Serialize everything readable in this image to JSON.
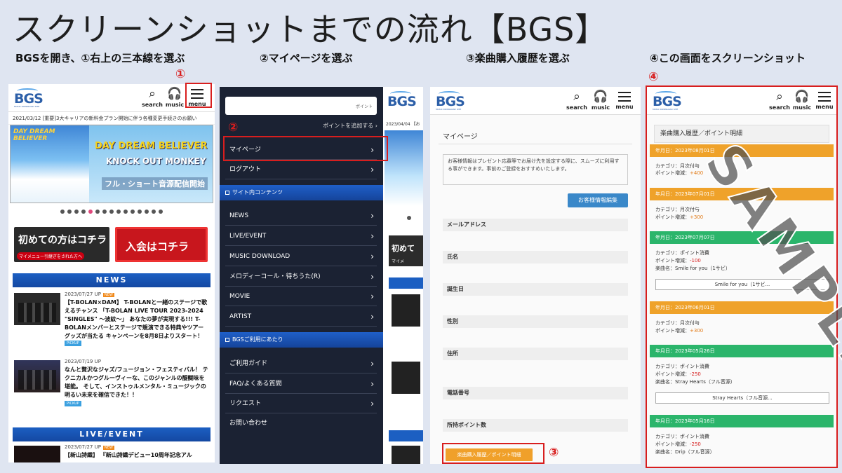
{
  "title": "スクリーンショットまでの流れ【BGS】",
  "steps": [
    "BGSを開き、①右上の三本線を選ぶ",
    "②マイページを選ぶ",
    "③楽曲購入履歴を選ぶ",
    "④この画面をスクリーンショット"
  ],
  "markers": [
    "①",
    "②",
    "③",
    "④"
  ],
  "header": {
    "logo": "BGS",
    "logo_sub": "MUSIC DOWNLOAD SITE",
    "search": "search",
    "music": "music",
    "menu": "menu"
  },
  "panel1": {
    "notice": "2021/03/12 [重要]3大キャリアの新料金プラン開始に伴う各種変更手続きのお願い",
    "banner": {
      "song": "DAY DREAM BELIEVER",
      "artist": "KNOCK OUT MONKEY",
      "caption": "フル・ショート音源配信開始"
    },
    "cta_first": "初めての方はコチラ",
    "cta_first_sub": "マイメニュー引継ぎをされた方へ",
    "cta_join": "入会はコチラ",
    "news_header": "NEWS",
    "news": [
      {
        "date": "2023/07/27 UP",
        "badge": "NEW",
        "text": "【T-BOLAN×DAM】 T-BOLANと一緒のステージで歌えるチャンス 「T-BOLAN LIVE TOUR 2023-2024 \"SINGLES\" ～波紋～」 あなたの夢が実現する!!! T-BOLANメンバーとステージで競演できる特典やツアーグッズが当たる キャンペーンを8月8日よりスタート！",
        "tag": "PICKUP"
      },
      {
        "date": "2023/07/19 UP",
        "badge": "",
        "text": "なんと贅沢なジャズ/フュージョン・フェスティバル！ テクニカルかつグルーヴィーな、このジャンルの醍醐味を堪能。 そして、インストゥルメンタル・ミュージックの明るい未来を確信できた！！",
        "tag": "PICKUP"
      }
    ],
    "live_header": "LIVE/EVENT",
    "live": [
      {
        "date": "2023/07/27 UP",
        "badge": "NEW",
        "text": "【新山詩織】 『新山詩織デビュー10周年記念アル"
      }
    ]
  },
  "panel2": {
    "search_placeholder": "ポイント",
    "points_add": "ポイントを追加する ›",
    "items_top": [
      "マイページ",
      "ログアウト"
    ],
    "section1": "サイト内コンテンツ",
    "items_mid": [
      "NEWS",
      "LIVE/EVENT",
      "MUSIC DOWNLOAD",
      "メロディーコール・待ちうた(R)",
      "MOVIE",
      "ARTIST"
    ],
    "section2": "BGSご利用にあたり",
    "items_bottom": [
      "ご利用ガイド",
      "FAQ/よくある質問",
      "リクエスト",
      "お問い合わせ"
    ],
    "peek_date": "2023/04/04 【お",
    "peek_cta": "初めて",
    "peek_cta_sub": "マイメ"
  },
  "panel3": {
    "title": "マイページ",
    "note": "お客様情報はプレゼント応募等でお届け先を設定する際に、スムーズに利用する事ができます。事前のご登録をおすすめいたします。",
    "edit_button": "お客様情報編集",
    "fields": [
      "メールアドレス",
      "氏名",
      "誕生日",
      "性別",
      "住所",
      "電話番号",
      "所持ポイント数"
    ],
    "history_button": "楽曲購入履歴／ポイント明細"
  },
  "panel4": {
    "title": "楽曲購入履歴／ポイント明細",
    "records": [
      {
        "head": "年月日：2023年08月01日",
        "color": "orange",
        "category": "カテゴリ：月次付与",
        "points": "ポイント増減：",
        "value": "+400",
        "song": "",
        "button": ""
      },
      {
        "head": "年月日：2023年07月01日",
        "color": "orange",
        "category": "カテゴリ：月次付与",
        "points": "ポイント増減：",
        "value": "+300",
        "song": "",
        "button": ""
      },
      {
        "head": "年月日：2023年07月07日",
        "color": "green",
        "category": "カテゴリ：ポイント消費",
        "points": "ポイント増減：",
        "value": "-100",
        "song": "楽曲名：Smile for you（1サビ）",
        "button": "Smile for you（1サビ..."
      },
      {
        "head": "年月日：2023年06月01日",
        "color": "orange",
        "category": "カテゴリ：月次付与",
        "points": "ポイント増減：",
        "value": "+300",
        "song": "",
        "button": ""
      },
      {
        "head": "年月日：2023年05月26日",
        "color": "green",
        "category": "カテゴリ：ポイント消費",
        "points": "ポイント増減：",
        "value": "-250",
        "song": "楽曲名：Stray Hearts（フル音源）",
        "button": "Stray Hearts（フル音源..."
      },
      {
        "head": "年月日：2023年05月16日",
        "color": "green",
        "category": "カテゴリ：ポイント消費",
        "points": "ポイント増減：",
        "value": "-250",
        "song": "楽曲名：Drip（フル音源）",
        "button": ""
      }
    ],
    "watermark": "SAMPLE"
  },
  "colors": {
    "accent_red": "#d81e1e",
    "orange": "#efa22a",
    "green": "#2bb56b",
    "nav_blue": "#1c5fc2",
    "menu_dark": "#1b2233"
  }
}
